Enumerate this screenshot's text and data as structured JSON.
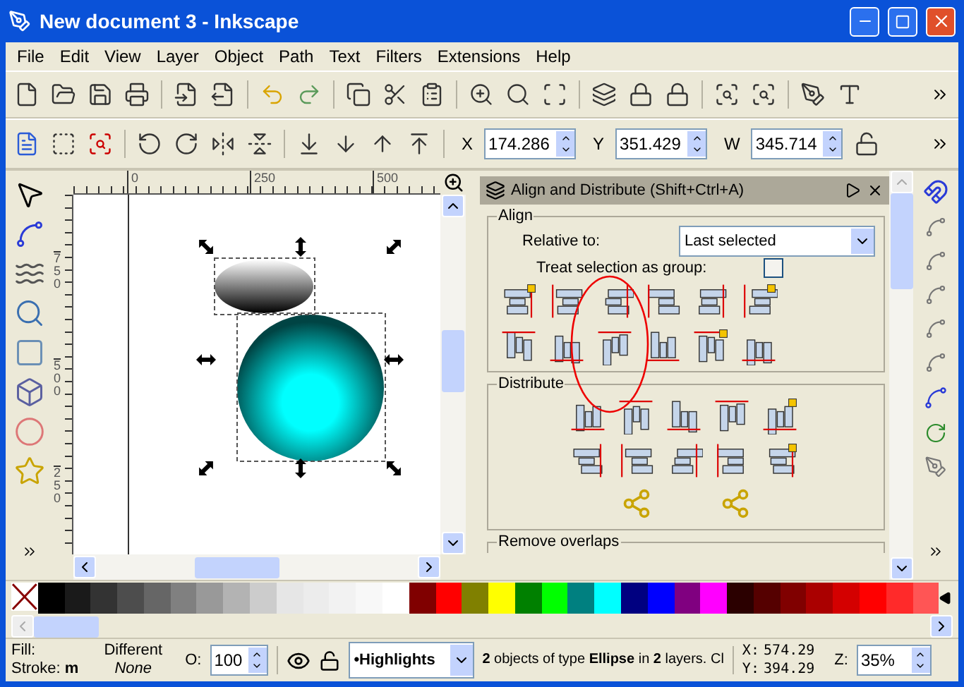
{
  "window": {
    "title": "New document 3 - Inkscape"
  },
  "menu": [
    "File",
    "Edit",
    "View",
    "Layer",
    "Object",
    "Path",
    "Text",
    "Filters",
    "Extensions",
    "Help"
  ],
  "tool_controls": [
    {
      "label": "X",
      "value": "174.286"
    },
    {
      "label": "Y",
      "value": "351.429"
    },
    {
      "label": "W",
      "value": "345.714"
    }
  ],
  "rulers": {
    "horizontal": [
      "0",
      "250",
      "500"
    ],
    "vertical": [
      "750",
      "500",
      "250"
    ]
  },
  "dialog": {
    "title": "Align and Distribute (Shift+Ctrl+A)",
    "align": {
      "label": "Align",
      "relative_label": "Relative to:",
      "relative_value": "Last selected",
      "group_label": "Treat selection as group:",
      "group_checked": false
    },
    "distribute": {
      "label": "Distribute"
    },
    "remove_overlaps": {
      "label": "Remove overlaps"
    }
  },
  "palette": [
    {
      "kind": "none"
    },
    {
      "kind": "color",
      "color": "#000000"
    },
    {
      "kind": "color",
      "color": "#1a1a1a"
    },
    {
      "kind": "color",
      "color": "#333333"
    },
    {
      "kind": "color",
      "color": "#4d4d4d"
    },
    {
      "kind": "color",
      "color": "#666666"
    },
    {
      "kind": "color",
      "color": "#808080"
    },
    {
      "kind": "color",
      "color": "#999999"
    },
    {
      "kind": "color",
      "color": "#b3b3b3"
    },
    {
      "kind": "color",
      "color": "#cccccc"
    },
    {
      "kind": "color",
      "color": "#e6e6e6"
    },
    {
      "kind": "color",
      "color": "#ececec"
    },
    {
      "kind": "color",
      "color": "#f2f2f2"
    },
    {
      "kind": "color",
      "color": "#f8f8f8"
    },
    {
      "kind": "color",
      "color": "#ffffff"
    },
    {
      "kind": "color",
      "color": "#800000"
    },
    {
      "kind": "color",
      "color": "#ff0000"
    },
    {
      "kind": "color",
      "color": "#808000"
    },
    {
      "kind": "color",
      "color": "#ffff00"
    },
    {
      "kind": "color",
      "color": "#008000"
    },
    {
      "kind": "color",
      "color": "#00ff00"
    },
    {
      "kind": "color",
      "color": "#008080"
    },
    {
      "kind": "color",
      "color": "#00ffff"
    },
    {
      "kind": "color",
      "color": "#000080"
    },
    {
      "kind": "color",
      "color": "#0000ff"
    },
    {
      "kind": "color",
      "color": "#800080"
    },
    {
      "kind": "color",
      "color": "#ff00ff"
    },
    {
      "kind": "color",
      "color": "#2b0000"
    },
    {
      "kind": "color",
      "color": "#550000"
    },
    {
      "kind": "color",
      "color": "#800000"
    },
    {
      "kind": "color",
      "color": "#aa0000"
    },
    {
      "kind": "color",
      "color": "#d40000"
    },
    {
      "kind": "color",
      "color": "#ff0000"
    },
    {
      "kind": "color",
      "color": "#ff2a2a"
    },
    {
      "kind": "color",
      "color": "#ff5555"
    }
  ],
  "status_bar": {
    "fill_label": "Fill:",
    "fill_value": "Different",
    "stroke_label": "Stroke:",
    "stroke_width": "m",
    "stroke_value": "None",
    "opacity_label": "O:",
    "opacity_value": "100",
    "layer": "•Highlights",
    "message": "**2** objects of type **Ellipse** in **2** layers. Cl",
    "x_label": "X:",
    "x_value": "574.29",
    "y_label": "Y:",
    "y_value": "394.29",
    "zoom_label": "Z:",
    "zoom_value": "35%"
  }
}
